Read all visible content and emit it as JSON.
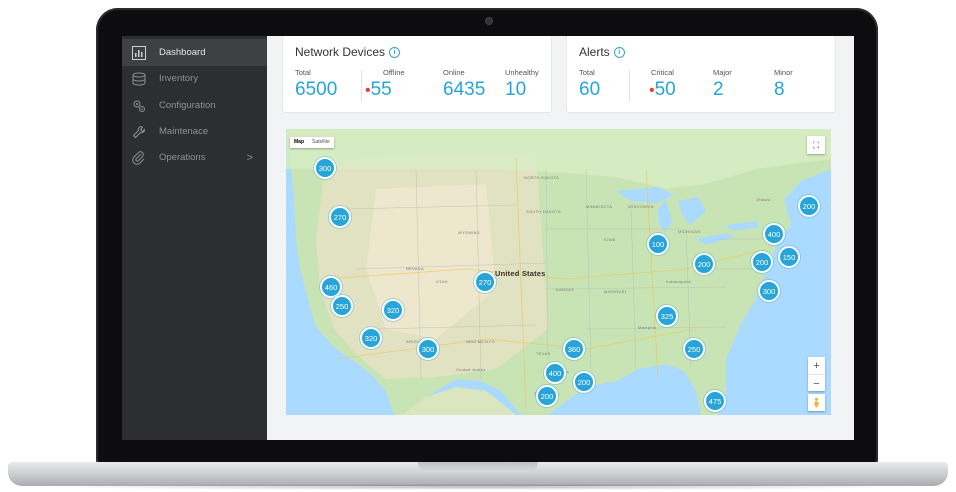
{
  "sidebar": {
    "items": [
      {
        "label": "Dashboard",
        "icon": "chart-icon",
        "active": true
      },
      {
        "label": "Inventory",
        "icon": "database-icon"
      },
      {
        "label": "Configuration",
        "icon": "gears-icon"
      },
      {
        "label": "Maintenace",
        "icon": "wrench-icon"
      },
      {
        "label": "Operations",
        "icon": "paperclip-icon",
        "chevron": ">"
      }
    ]
  },
  "network": {
    "title": "Network Devices",
    "stats": [
      {
        "label": "Total",
        "value": "6500"
      },
      {
        "label": "Offline",
        "value": "55",
        "dot": "•"
      },
      {
        "label": "Online",
        "value": "6435"
      },
      {
        "label": "Unhealthy",
        "value": "10"
      }
    ]
  },
  "alerts": {
    "title": "Alerts",
    "stats": [
      {
        "label": "Total",
        "value": "60"
      },
      {
        "label": "Critical",
        "value": "50",
        "dot": "•"
      },
      {
        "label": "Major",
        "value": "2"
      },
      {
        "label": "Minor",
        "value": "8"
      }
    ]
  },
  "map": {
    "toggle": [
      "Map",
      "Satellite"
    ],
    "country_label": "United States",
    "region_labels": [
      "NEVADA",
      "UTAH",
      "WYOMING",
      "NEW MEXICO",
      "TEXAS",
      "KANSAS",
      "IOWA",
      "MISSOURI",
      "ARIZONA",
      "Ciudad Juárez",
      "MICHIGAN",
      "WISCONSIN",
      "MINNESOTA",
      "SOUTH DAKOTA",
      "NORTH DAKOTA",
      "Ottawa",
      "Indianapolis",
      "Memphis",
      "Dallas",
      "San Antonio"
    ],
    "zoom_in": "+",
    "zoom_out": "−",
    "clusters": [
      "300",
      "270",
      "460",
      "250",
      "320",
      "320",
      "300",
      "270",
      "100",
      "200",
      "400",
      "200",
      "200",
      "150",
      "300",
      "325",
      "250",
      "360",
      "400",
      "200",
      "200",
      "475"
    ]
  },
  "colors": {
    "accent": "#27a4d9",
    "alert_dot": "#e2403a",
    "sidebar": "#2d2e30"
  }
}
